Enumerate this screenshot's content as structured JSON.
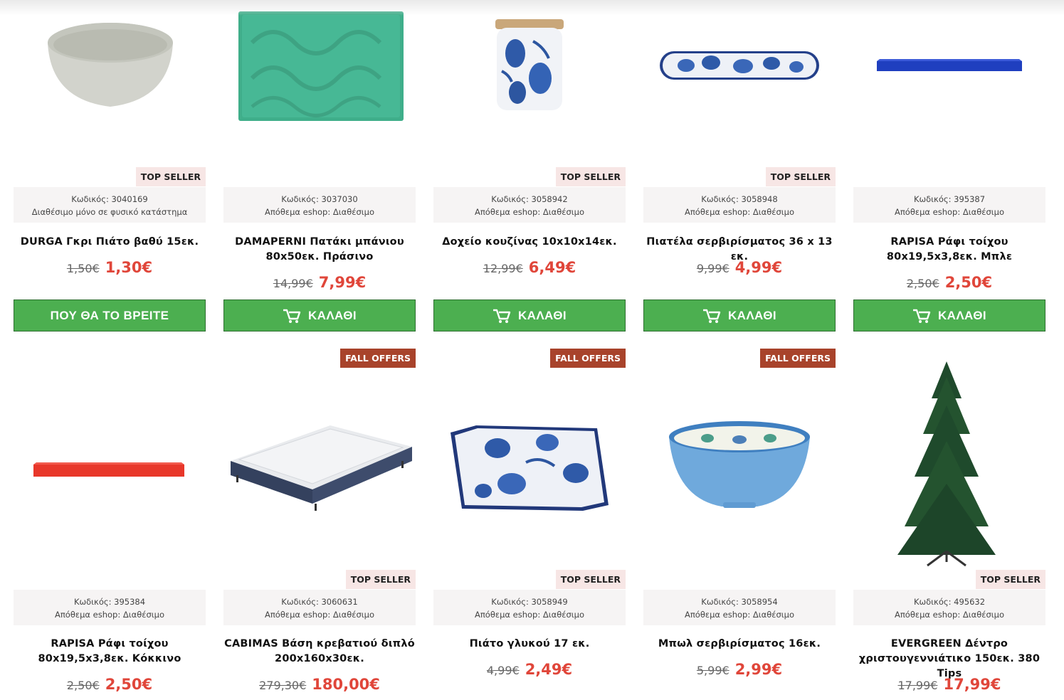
{
  "colors": {
    "button_green": "#4caf50",
    "price_red": "#e0463a",
    "fall_offers_badge": "#a8432b",
    "top_seller_badge": "#f7e6e5",
    "info_bg": "#f6f4f4"
  },
  "row1": [
    {
      "badge": "TOP SELLER",
      "code": "Κωδικός: 3040169",
      "stock": "Διαθέσιμο μόνο σε φυσικό κατάστημα",
      "title_l1": "DURGA Γκρι Πιάτο βαθύ 15εκ.",
      "title_l2": "",
      "old_price": "1,50€",
      "new_price": "1,30€",
      "button": "ΠΟΥ ΘΑ ΤΟ ΒΡΕΙΤΕ",
      "button_icon": "none"
    },
    {
      "badge": "",
      "code": "Κωδικός: 3037030",
      "stock": "Απόθεμα eshop: Διαθέσιμο",
      "title_l1": "DAMAPERNI Πατάκι μπάνιου",
      "title_l2": "80x50εκ. Πράσινο",
      "old_price": "14,99€",
      "new_price": "7,99€",
      "button": "ΚΑΛΑΘΙ",
      "button_icon": "cart-icon"
    },
    {
      "badge": "TOP SELLER",
      "code": "Κωδικός: 3058942",
      "stock": "Απόθεμα eshop: Διαθέσιμο",
      "title_l1": "Δοχείο κουζίνας 10x10x14εκ.",
      "title_l2": "",
      "old_price": "12,99€",
      "new_price": "6,49€",
      "button": "ΚΑΛΑΘΙ",
      "button_icon": "cart-icon"
    },
    {
      "badge": "TOP SELLER",
      "code": "Κωδικός: 3058948",
      "stock": "Απόθεμα eshop: Διαθέσιμο",
      "title_l1": "Πιατέλα σερβιρίσματος 36 x 13 εκ.",
      "title_l2": "",
      "old_price": "9,99€",
      "new_price": "4,99€",
      "button": "ΚΑΛΑΘΙ",
      "button_icon": "cart-icon"
    },
    {
      "badge": "",
      "code": "Κωδικός: 395387",
      "stock": "Απόθεμα eshop: Διαθέσιμο",
      "title_l1": "RAPISA Ράφι τοίχου",
      "title_l2": "80x19,5x3,8εκ. Μπλε",
      "old_price": "2,50€",
      "new_price": "2,50€",
      "button": "ΚΑΛΑΘΙ",
      "button_icon": "cart-icon"
    }
  ],
  "row2": [
    {
      "badge_fall": "",
      "badge_top": "",
      "code": "Κωδικός: 395384",
      "stock": "Απόθεμα eshop: Διαθέσιμο",
      "title_l1": "RAPISA Ράφι τοίχου",
      "title_l2": "80x19,5x3,8εκ. Κόκκινο",
      "old_price": "2,50€",
      "new_price": "2,50€"
    },
    {
      "badge_fall": "FALL OFFERS",
      "badge_top": "TOP SELLER",
      "code": "Κωδικός: 3060631",
      "stock": "Απόθεμα eshop: Διαθέσιμο",
      "title_l1": "CABIMAS Βάση κρεβατιού διπλό",
      "title_l2": "200x160x30εκ.",
      "old_price": "279,30€",
      "new_price": "180,00€"
    },
    {
      "badge_fall": "FALL OFFERS",
      "badge_top": "TOP SELLER",
      "code": "Κωδικός: 3058949",
      "stock": "Απόθεμα eshop: Διαθέσιμο",
      "title_l1": "Πιάτο γλυκού 17 εκ.",
      "title_l2": "",
      "old_price": "4,99€",
      "new_price": "2,49€"
    },
    {
      "badge_fall": "FALL OFFERS",
      "badge_top": "",
      "code": "Κωδικός: 3058954",
      "stock": "Απόθεμα eshop: Διαθέσιμο",
      "title_l1": "Μπωλ σερβιρίσματος 16εκ.",
      "title_l2": "",
      "old_price": "5,99€",
      "new_price": "2,99€"
    },
    {
      "badge_fall": "",
      "badge_top": "TOP SELLER",
      "code": "Κωδικός: 495632",
      "stock": "Απόθεμα eshop: Διαθέσιμο",
      "title_l1": "EVERGREEN Δέντρο",
      "title_l2": "χριστουγεννιάτικο 150εκ. 380 Tips",
      "old_price": "17,99€",
      "new_price": "17,99€"
    }
  ],
  "images": [
    "grey-bowl",
    "green-bath-mat",
    "blue-lemon-canister",
    "blue-lemon-platter",
    "blue-wall-shelf",
    "red-wall-shelf",
    "bed-base",
    "blue-lemon-square-plate",
    "blue-fish-bowl",
    "christmas-tree"
  ]
}
